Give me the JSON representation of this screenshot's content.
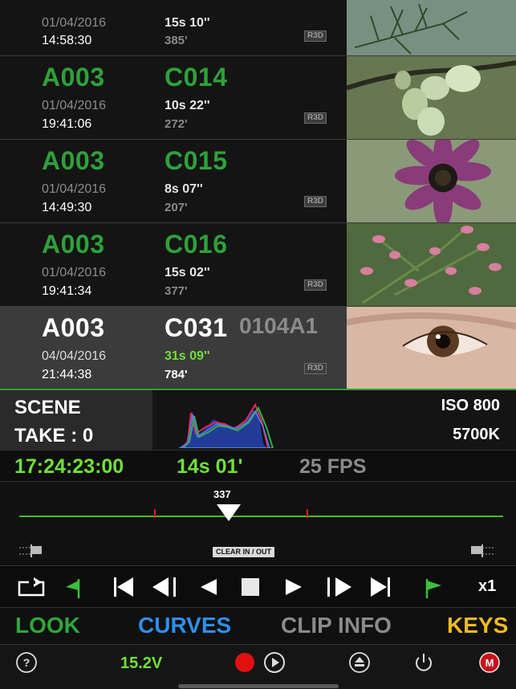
{
  "clips": [
    {
      "reel": "",
      "clip": "",
      "extra": "",
      "date": "01/04/2016",
      "time": "14:58:30",
      "duration": "15s 10''",
      "frames": "385'",
      "format": "R3D",
      "thumb": "pine-needles"
    },
    {
      "reel": "A003",
      "clip": "C014",
      "extra": "",
      "date": "01/04/2016",
      "time": "19:41:06",
      "duration": "10s 22''",
      "frames": "272'",
      "format": "R3D",
      "thumb": "flower-buds"
    },
    {
      "reel": "A003",
      "clip": "C015",
      "extra": "",
      "date": "01/04/2016",
      "time": "14:49:30",
      "duration": "8s 07''",
      "frames": "207'",
      "format": "R3D",
      "thumb": "purple-daisy"
    },
    {
      "reel": "A003",
      "clip": "C016",
      "extra": "",
      "date": "01/04/2016",
      "time": "19:41:34",
      "duration": "15s 02''",
      "frames": "377'",
      "format": "R3D",
      "thumb": "pink-blossoms"
    },
    {
      "reel": "A003",
      "clip": "C031",
      "extra": "0104A1",
      "date": "04/04/2016",
      "time": "21:44:38",
      "duration": "31s 09''",
      "frames": "784'",
      "format": "R3D",
      "thumb": "eye-closeup",
      "selected": true
    }
  ],
  "meta": {
    "scene": "SCENE",
    "take": "TAKE : 0",
    "iso": "ISO 800",
    "white_balance": "5700K"
  },
  "timecode": {
    "tc": "17:24:23:00",
    "duration": "14s 01'",
    "fps": "25 FPS"
  },
  "timeline": {
    "playhead_frame": "337",
    "clear_label": "CLEAR IN / OUT"
  },
  "transport": {
    "speed": "x1",
    "icons": [
      "loop-icon",
      "mark-in-icon",
      "skip-start-icon",
      "step-back-icon",
      "play-reverse-icon",
      "stop-icon",
      "play-icon",
      "step-forward-icon",
      "skip-end-icon",
      "mark-out-icon"
    ]
  },
  "tabs": {
    "look": "LOOK",
    "curves": "CURVES",
    "clip_info": "CLIP INFO",
    "keys": "KEYS"
  },
  "status": {
    "voltage": "15.2V",
    "icons": [
      "help-icon",
      "record-icon",
      "play-circle-icon",
      "eject-icon",
      "power-icon",
      "m-badge-icon"
    ]
  },
  "colors": {
    "accent_green": "#6fe03a",
    "clip_green": "#2fa03a",
    "curves_blue": "#2f8fe8",
    "keys_yellow": "#eebc1e",
    "record_red": "#e02020"
  }
}
